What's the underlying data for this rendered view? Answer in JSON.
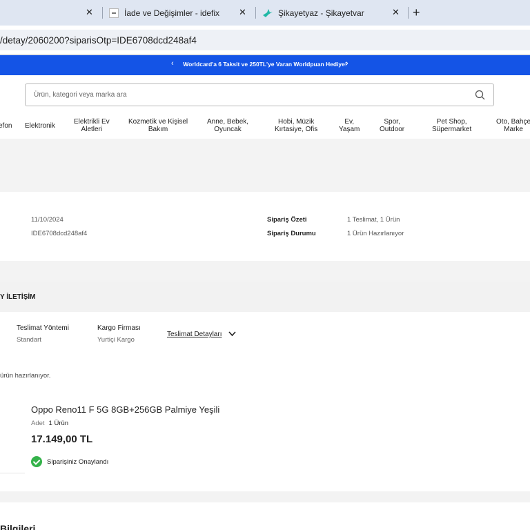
{
  "browser": {
    "tabs": [
      {
        "title": "İade ve Değişimler - idefix",
        "favicon": "idefix-favicon"
      },
      {
        "title": "Şikayetyaz - Şikayetvar",
        "favicon": "sikayetvar-bird-icon"
      }
    ],
    "url": "/detay/2060200?siparisOtp=IDE6708dcd248af4",
    "colors": {
      "tabbar": "#dfe6f2",
      "address_field": "#eef1f6"
    }
  },
  "promo": {
    "text": "Worldcard'a 6 Taksit ve 250TL'ye Varan Worldpuan Hediye!",
    "color": "#1454e6"
  },
  "search": {
    "placeholder": "Ürün, kategori veya marka ara"
  },
  "nav": [
    {
      "line1": "efon",
      "line2": ""
    },
    {
      "line1": "Elektronik",
      "line2": ""
    },
    {
      "line1": "Elektrikli Ev",
      "line2": "Aletleri"
    },
    {
      "line1": "Kozmetik ve Kişisel",
      "line2": "Bakım"
    },
    {
      "line1": "Anne, Bebek,",
      "line2": "Oyuncak"
    },
    {
      "line1": "Hobi, Müzik",
      "line2": "Kırtasiye, Ofis"
    },
    {
      "line1": "Ev,",
      "line2": "Yaşam"
    },
    {
      "line1": "Spor,",
      "line2": "Outdoor"
    },
    {
      "line1": "Pet Shop,",
      "line2": "Süpermarket"
    },
    {
      "line1": "Oto, Bahçe",
      "line2": "Marke"
    }
  ],
  "order": {
    "date": "11/10/2024",
    "number": "IDE6708dcd248af4",
    "summary_label": "Sipariş Özeti",
    "summary_value": "1 Teslimat, 1 Ürün",
    "status_label": "Sipariş Durumu",
    "status_value": "1 Ürün Hazırlanıyor"
  },
  "delivery": {
    "title": "Y İLETİŞİM",
    "method_label": "Teslimat Yöntemi",
    "method_value": "Standart",
    "carrier_label": "Kargo Firması",
    "carrier_value": "Yurtiçi Kargo",
    "details_link": "Teslimat Detayları",
    "status_note": "ürün hazırlanıyor."
  },
  "product": {
    "name": "Oppo Reno11 F 5G 8GB+256GB Palmiye Yeşili",
    "qty_label": "Adet",
    "qty_value": "1 Ürün",
    "price": "17.149,00 TL",
    "confirmation": "Siparişiniz Onaylandı",
    "confirm_color": "#34b24a"
  },
  "billing": {
    "title": "Bilgileri"
  }
}
